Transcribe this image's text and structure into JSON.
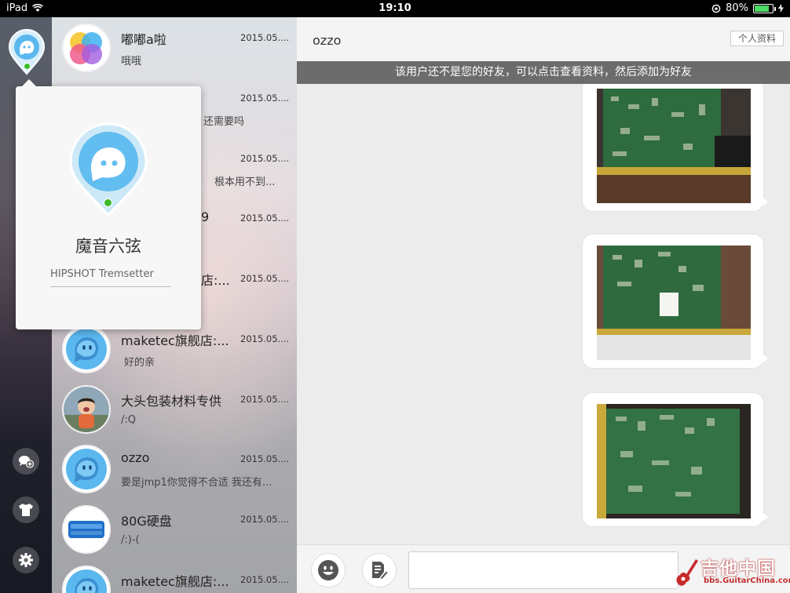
{
  "status_bar": {
    "device": "iPad",
    "time": "19:10",
    "battery": "80%",
    "battery_level": 0.8
  },
  "popover": {
    "name": "魔音六弦",
    "signature": "HIPSHOT Tremsetter"
  },
  "conversations": [
    {
      "name": "嘟嘟a啦",
      "date": "2015.05....",
      "preview": "哦哦",
      "avatar": "game-center-icon"
    },
    {
      "name": "",
      "date": "2015.05....",
      "preview": "还需要吗",
      "avatar": "hidden"
    },
    {
      "name": "",
      "date": "2015.05....",
      "preview": "根本用不到...",
      "avatar": "hidden"
    },
    {
      "name": "9",
      "date": "2015.05....",
      "preview": "",
      "avatar": "hidden"
    },
    {
      "name": "店:...",
      "date": "2015.05....",
      "preview": "",
      "avatar": "hidden"
    },
    {
      "name": "maketec旗舰店:...",
      "date": "2015.05....",
      "preview": "好的亲",
      "avatar": "default-avatar-icon"
    },
    {
      "name": "大头包装材料专供",
      "date": "2015.05....",
      "preview": "/:Q",
      "avatar": "child-photo"
    },
    {
      "name": "ozzo",
      "date": "2015.05....",
      "preview": "要是jmp1你觉得不合适  我还有...",
      "avatar": "default-avatar-icon"
    },
    {
      "name": "80G硬盘",
      "date": "2015.05....",
      "preview": "/:)-(",
      "avatar": "hard-drive-label"
    },
    {
      "name": "maketec旗舰店:...",
      "date": "2015.05....",
      "preview": "",
      "avatar": "default-avatar-icon"
    }
  ],
  "chat": {
    "title": "ozzo",
    "profile_button": "个人资料",
    "notice": "该用户还不是您的好友，可以点击查看资料，然后添加为好友",
    "input_placeholder": ""
  },
  "watermark": {
    "title": "吉他中国",
    "subtitle": "bbs.GuitarChina.com"
  },
  "colors": {
    "online_dot": "#3dbb2a",
    "avatar_blue": "#5bb8ef",
    "notice_bg": "#5a5a5a"
  }
}
